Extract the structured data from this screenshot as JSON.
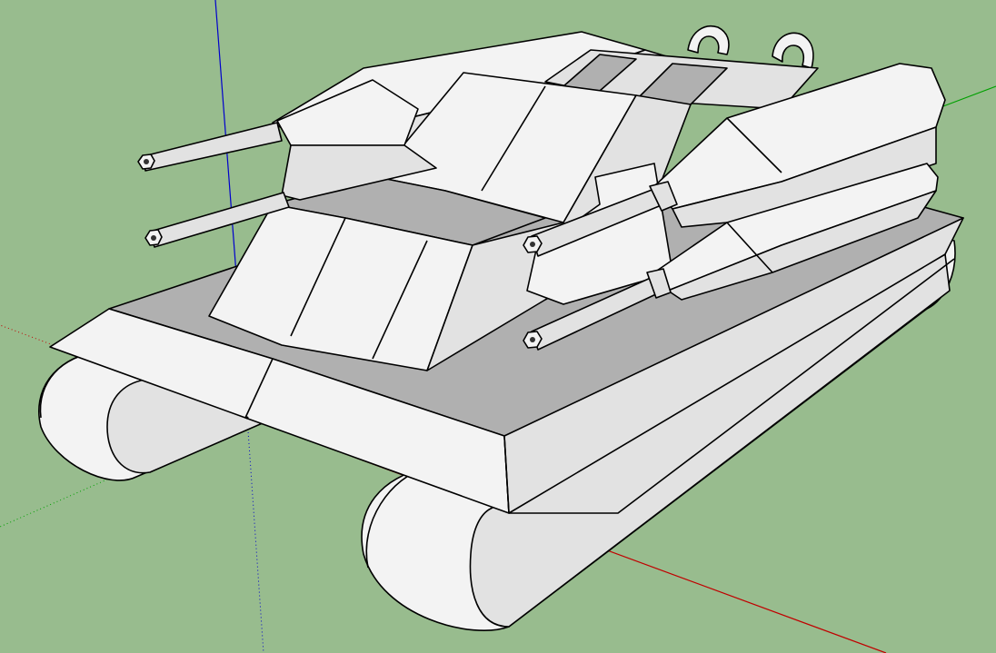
{
  "scene": {
    "background_color": "#98bc8e",
    "model_color": "#e8e8e8",
    "edge_color": "#000000",
    "axes": {
      "red": "#c00000",
      "green": "#00a000",
      "blue": "#0000cc"
    }
  }
}
